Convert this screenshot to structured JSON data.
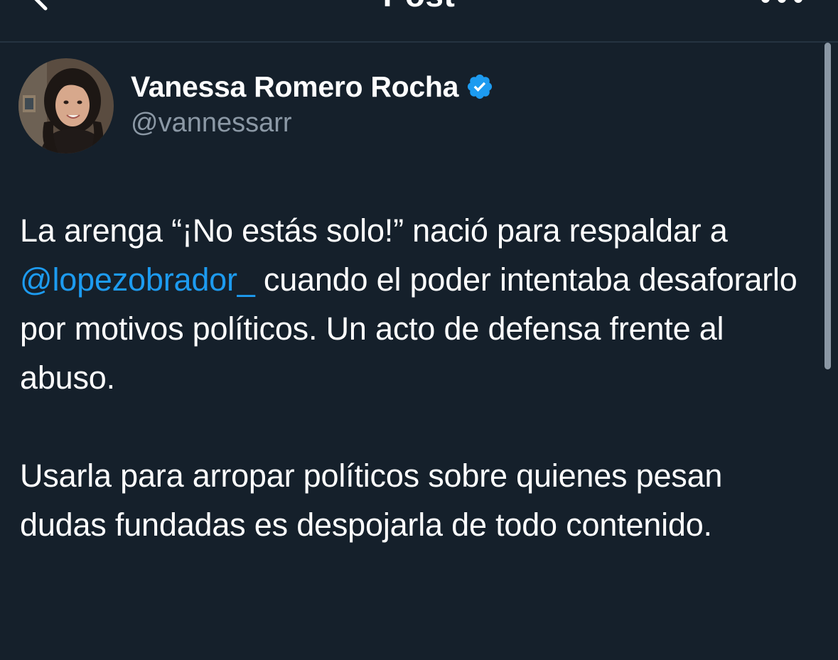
{
  "header": {
    "title": "Post",
    "back_icon": "chevron-left-icon",
    "more_icon": "more-horizontal-icon"
  },
  "author": {
    "display_name": "Vanessa Romero Rocha",
    "handle": "@vannessarr",
    "verified_icon": "verified-badge-icon",
    "verified_color": "#1d9bf0"
  },
  "post": {
    "paragraph1": {
      "before_mention": "La arenga “¡No estás solo!” nació para respaldar a ",
      "mention": "@lopezobrador_",
      "after_mention": " cuando el poder intentaba desaforarlo por motivos políticos. Un acto de defensa frente al abuso."
    },
    "paragraph2": "Usarla para arropar políticos sobre quienes pesan dudas fundadas es despojarla de todo contenido."
  },
  "colors": {
    "background": "#15202b",
    "text": "#ffffff",
    "secondary_text": "#8b98a5",
    "link": "#1d9bf0"
  }
}
